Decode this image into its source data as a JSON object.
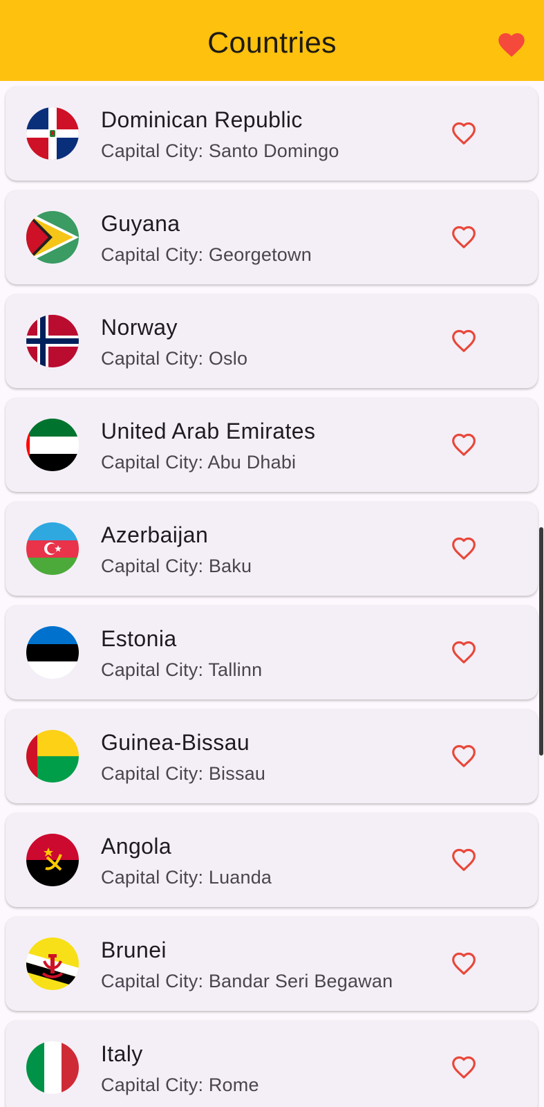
{
  "appbar": {
    "title": "Countries",
    "favorites_icon": "heart-filled-icon",
    "background": "#fdc10e"
  },
  "heart_color": "#e8473a",
  "countries": [
    {
      "name": "Dominican Republic",
      "capital": "Capital City: Santo Domingo",
      "flag": "dominican-republic-flag",
      "favorite_icon": "heart-outline-icon"
    },
    {
      "name": "Guyana",
      "capital": "Capital City: Georgetown",
      "flag": "guyana-flag",
      "favorite_icon": "heart-outline-icon"
    },
    {
      "name": "Norway",
      "capital": "Capital City: Oslo",
      "flag": "norway-flag",
      "favorite_icon": "heart-outline-icon"
    },
    {
      "name": "United Arab Emirates",
      "capital": "Capital City: Abu Dhabi",
      "flag": "uae-flag",
      "favorite_icon": "heart-outline-icon"
    },
    {
      "name": "Azerbaijan",
      "capital": "Capital City: Baku",
      "flag": "azerbaijan-flag",
      "favorite_icon": "heart-outline-icon"
    },
    {
      "name": "Estonia",
      "capital": "Capital City: Tallinn",
      "flag": "estonia-flag",
      "favorite_icon": "heart-outline-icon"
    },
    {
      "name": "Guinea-Bissau",
      "capital": "Capital City: Bissau",
      "flag": "guinea-bissau-flag",
      "favorite_icon": "heart-outline-icon"
    },
    {
      "name": "Angola",
      "capital": "Capital City: Luanda",
      "flag": "angola-flag",
      "favorite_icon": "heart-outline-icon"
    },
    {
      "name": "Brunei",
      "capital": "Capital City: Bandar Seri Begawan",
      "flag": "brunei-flag",
      "favorite_icon": "heart-outline-icon"
    },
    {
      "name": "Italy",
      "capital": "Capital City: Rome",
      "flag": "italy-flag",
      "favorite_icon": "heart-outline-icon"
    }
  ]
}
